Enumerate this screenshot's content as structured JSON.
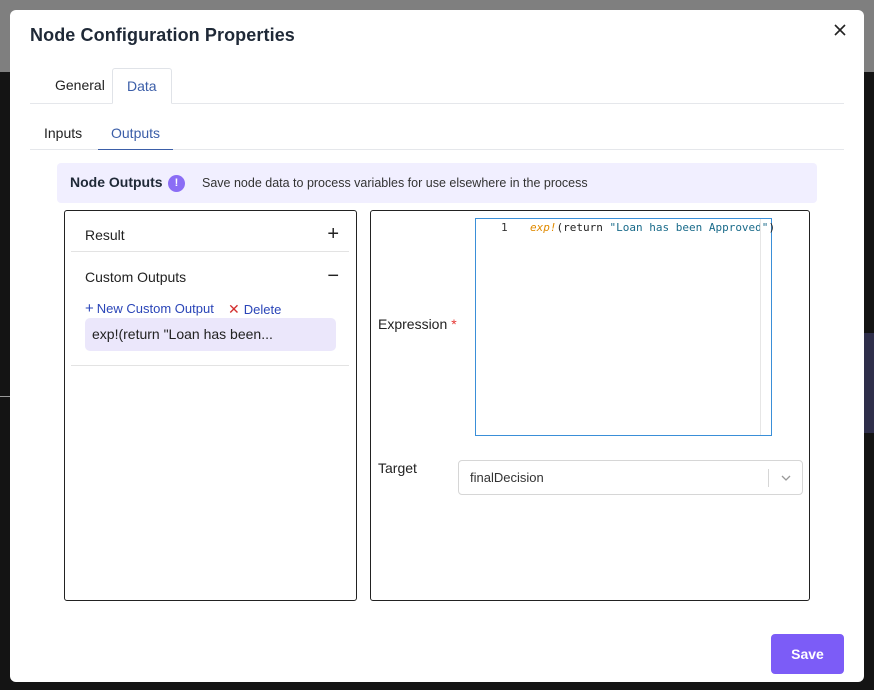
{
  "modal": {
    "title": "Node Configuration Properties"
  },
  "tabs": [
    {
      "label": "General"
    },
    {
      "label": "Data"
    }
  ],
  "subtabs": [
    {
      "label": "Inputs"
    },
    {
      "label": "Outputs"
    }
  ],
  "info": {
    "title": "Node Outputs",
    "icon": "exclamation-icon",
    "description": "Save node data to process variables for use elsewhere in the process"
  },
  "left_panel": {
    "sections": [
      {
        "label": "Result",
        "toggle": "+"
      },
      {
        "label": "Custom Outputs",
        "toggle": "−"
      }
    ],
    "new_custom_output": "New Custom Output",
    "delete": "Delete",
    "items": [
      {
        "label": "exp!(return \"Loan has been..."
      }
    ]
  },
  "right_panel": {
    "expression_label": "Expression",
    "required_mark": "*",
    "code": {
      "line_number": "1",
      "keyword": "exp!",
      "open": "(return ",
      "string": "\"Loan has been Approved\"",
      "close": ")"
    },
    "target_label": "Target",
    "target_value": "finalDecision"
  },
  "footer": {
    "save_label": "Save"
  },
  "colors": {
    "accent": "#7c5cf7",
    "link": "#2a45b8",
    "active_tab": "#3b5ea8",
    "info_bg": "#f1efff"
  }
}
